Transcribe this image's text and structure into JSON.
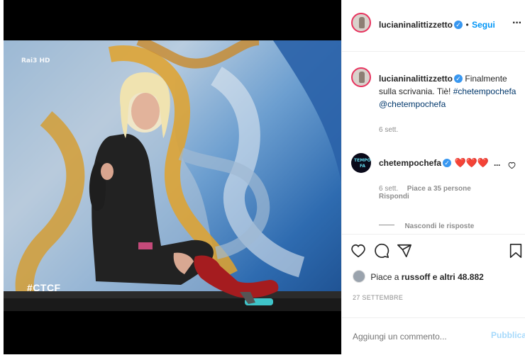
{
  "post": {
    "username": "lucianinalittizzetto",
    "follow_label": "Segui",
    "caption_text": "Finalmente sulla scrivania. Tiè!",
    "caption_hashtag": "#chetempochefa",
    "caption_mention": "@chetempochefa",
    "caption_time": "6 sett.",
    "likes_prefix": "Piace a",
    "likes_user": "russoff",
    "likes_suffix": "e altri 48.882",
    "date": "27 SETTEMBRE"
  },
  "media": {
    "channel_logo": "Rai3 HD",
    "hashtag_overlay": "#CTCF"
  },
  "comment": {
    "username": "chetempochefa",
    "hearts": "❤️❤️❤️",
    "avatar_text_1": "TEMPO",
    "avatar_text_2": "FA",
    "time": "6 sett.",
    "likes": "Piace a 35 persone",
    "reply": "Rispondi",
    "hide_replies": "Nascondi le risposte"
  },
  "compose": {
    "placeholder": "Aggiungi un commento...",
    "publish_label": "Pubblica"
  },
  "colors": {
    "accent_blue": "#0095f6",
    "verified_blue": "#3897f0",
    "heart_red": "#ed2b3a",
    "boot_red": "#a51c1f"
  },
  "icons": [
    "more-icon",
    "verified-icon",
    "heart-icon",
    "comment-icon",
    "share-icon",
    "bookmark-icon"
  ]
}
